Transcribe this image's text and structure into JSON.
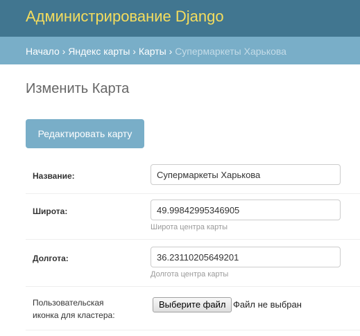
{
  "header": {
    "site_name": "Администрирование Django"
  },
  "breadcrumbs": {
    "items": [
      "Начало",
      "Яндекс карты",
      "Карты"
    ],
    "separator": "›",
    "current": "Супермаркеты Харькова"
  },
  "page": {
    "title": "Изменить Карта"
  },
  "toolbar": {
    "edit_map_label": "Редактировать карту"
  },
  "form": {
    "name": {
      "label": "Название:",
      "value": "Супермаркеты Харькова"
    },
    "latitude": {
      "label": "Широта:",
      "value": "49.99842995346905",
      "help": "Широта центра карты"
    },
    "longitude": {
      "label": "Долгота:",
      "value": "36.23110205649201",
      "help": "Долгота центра карты"
    },
    "cluster_icon": {
      "label_line1": "Пользовательская",
      "label_line2": "иконка для кластера:",
      "button_label": "Выберите файл",
      "status": "Файл не выбран"
    }
  },
  "colors": {
    "header_bg": "#417690",
    "site_name": "#f5dd5d",
    "breadcrumbs_bg": "#79aec8",
    "button_bg": "#79aec8"
  }
}
